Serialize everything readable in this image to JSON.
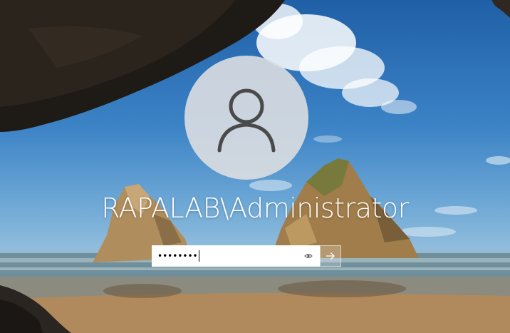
{
  "login": {
    "username": "RAPALAB\\Administrator",
    "password_mask": "••••••••",
    "reveal_icon": "eye-icon",
    "submit_icon": "arrow-right-icon",
    "avatar_icon": "user-silhouette-icon"
  },
  "background": {
    "subject": "sea-cave-beach-rocks"
  },
  "colors": {
    "sky_top": "#1f5fa6",
    "avatar_bg": "#dcdee1",
    "text": "#ffffff"
  }
}
